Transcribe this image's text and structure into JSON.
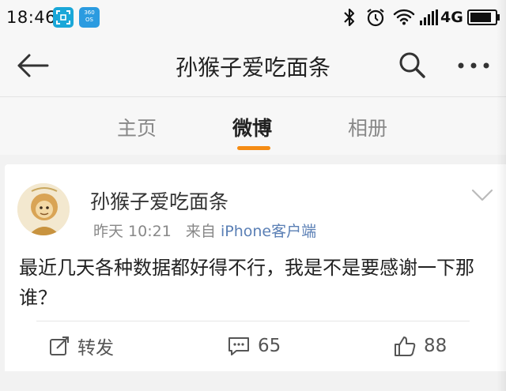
{
  "status_bar": {
    "time": "18:46",
    "app_icon_2_label": "360\nOS",
    "network": "4G",
    "icons": [
      "scan-app-icon",
      "360os-app-icon",
      "bluetooth-icon",
      "alarm-icon",
      "wifi-icon",
      "signal-icon",
      "battery-icon"
    ]
  },
  "header": {
    "title": "孙猴子爱吃面条",
    "icons": [
      "back-arrow-icon",
      "search-icon",
      "more-icon"
    ]
  },
  "tabs": [
    {
      "label": "主页",
      "active": false
    },
    {
      "label": "微博",
      "active": true
    },
    {
      "label": "相册",
      "active": false
    }
  ],
  "colors": {
    "accent": "#f58c14",
    "link": "#5a7fb5"
  },
  "post": {
    "author": "孙猴子爱吃面条",
    "time": "昨天 10:21",
    "source_prefix": "来自",
    "source": "iPhone客户端",
    "text": "最近几天各种数据都好得不行，我是不是要感谢一下那谁？",
    "actions": {
      "repost_label": "转发",
      "comment_count": "65",
      "like_count": "88"
    }
  }
}
